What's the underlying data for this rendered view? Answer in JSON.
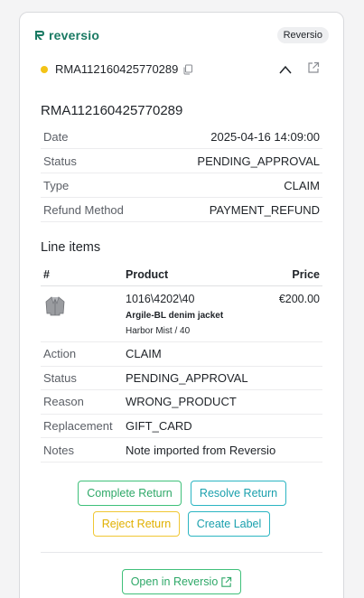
{
  "brand": {
    "name": "reversio",
    "tag": "Reversio",
    "color": "#1a7a63"
  },
  "header": {
    "rma_id": "RMA112160425770289",
    "status_color": "#f3c316"
  },
  "title": "RMA112160425770289",
  "meta": [
    {
      "label": "Date",
      "value": "2025-04-16 14:09:00"
    },
    {
      "label": "Status",
      "value": "PENDING_APPROVAL"
    },
    {
      "label": "Type",
      "value": "CLAIM"
    },
    {
      "label": "Refund Method",
      "value": "PAYMENT_REFUND"
    }
  ],
  "line_items": {
    "title": "Line items",
    "columns": {
      "hash": "#",
      "product": "Product",
      "price": "Price"
    },
    "product": {
      "sku": "1016\\4202\\40",
      "name": "Argile-BL denim jacket",
      "variant": "Harbor Mist / 40",
      "price": "€200.00"
    },
    "details": [
      {
        "label": "Action",
        "value": "CLAIM"
      },
      {
        "label": "Status",
        "value": "PENDING_APPROVAL"
      },
      {
        "label": "Reason",
        "value": "WRONG_PRODUCT"
      },
      {
        "label": "Replacement",
        "value": "GIFT_CARD"
      },
      {
        "label": "Notes",
        "value": "Note imported from Reversio"
      }
    ]
  },
  "actions": {
    "complete": "Complete Return",
    "resolve": "Resolve Return",
    "reject": "Reject Return",
    "create_label": "Create Label",
    "open": "Open in Reversio"
  },
  "icons": {
    "logo": "reversio-logo-icon",
    "copy": "copy-icon",
    "collapse": "chevron-up-icon",
    "external": "external-link-icon",
    "product": "jacket-thumbnail"
  },
  "colors": {
    "green": "#3fc07a",
    "teal": "#2bb5c2",
    "yellow": "#f0c733"
  }
}
